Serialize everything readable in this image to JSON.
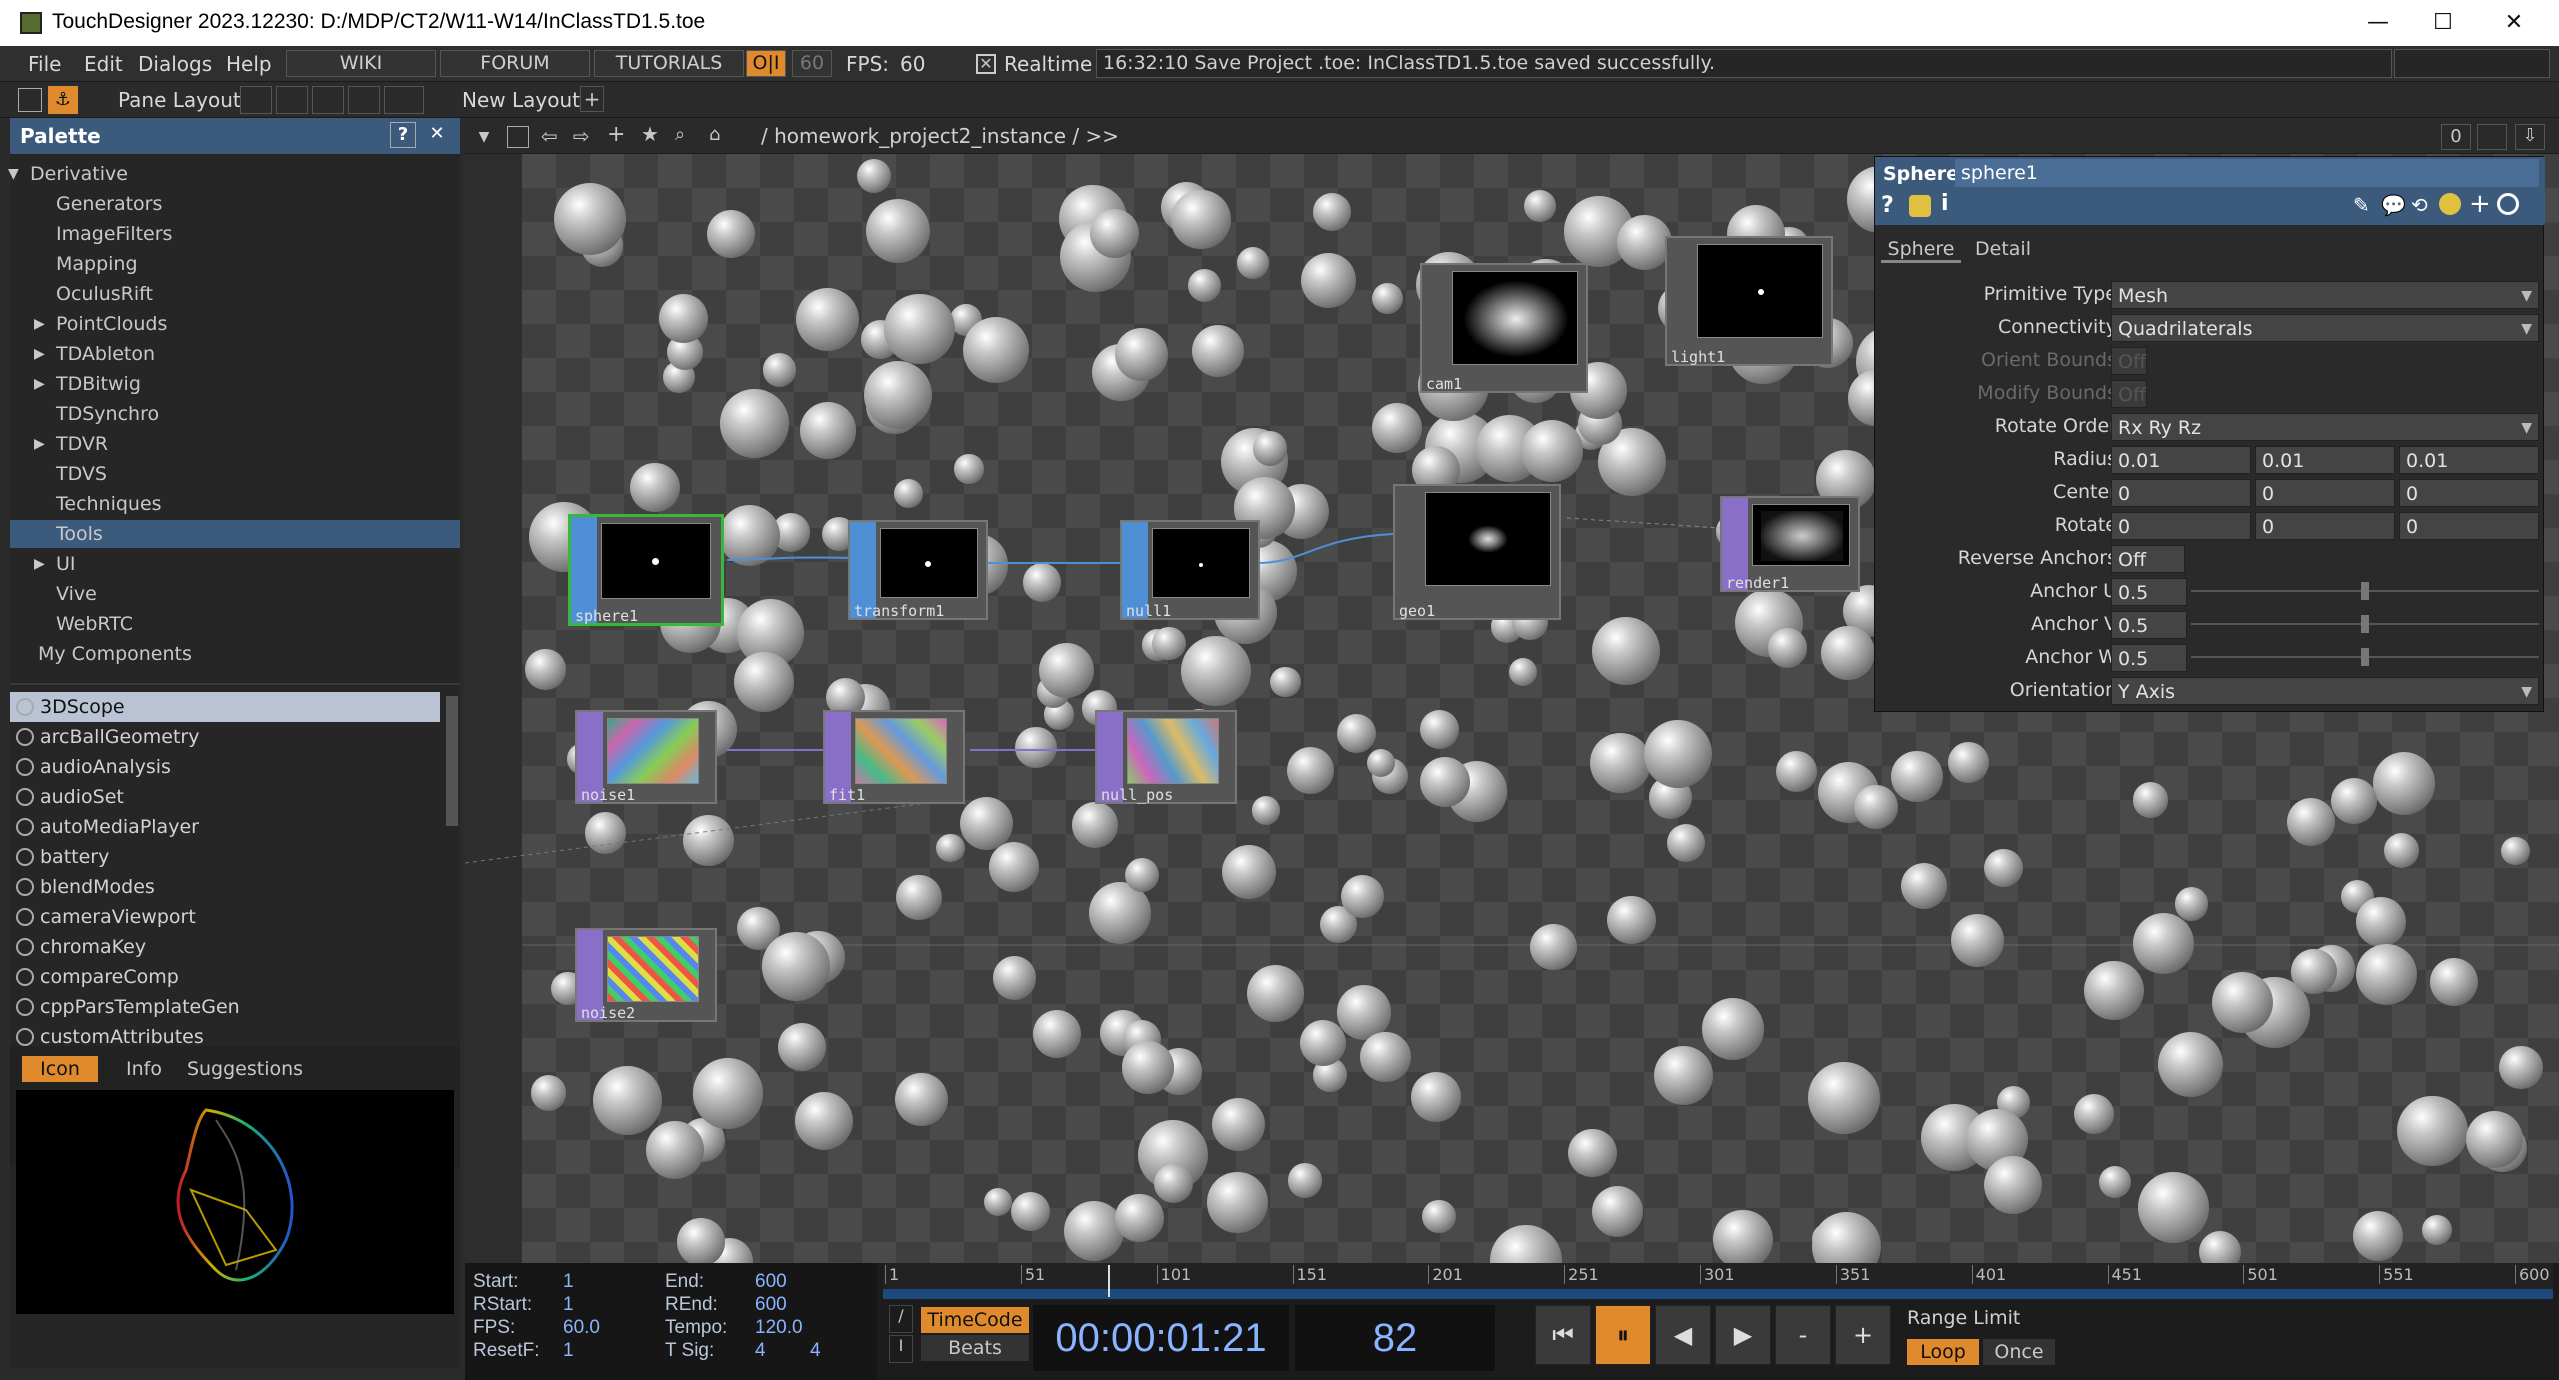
{
  "window": {
    "title": "TouchDesigner 2023.12230: D:/MDP/CT2/W11-W14/InClassTD1.5.toe",
    "minimize": "—",
    "maximize": "☐",
    "close": "✕"
  },
  "menu": {
    "file": "File",
    "edit": "Edit",
    "dialogs": "Dialogs",
    "help": "Help",
    "wiki": "WIKI",
    "forum": "FORUM",
    "tutorials": "TUTORIALS",
    "oi": "O|I",
    "fps_target": "60",
    "fps_label": "FPS:",
    "fps_value": "60",
    "realtime_label": "Realtime",
    "status": "16:32:10 Save Project .toe: InClassTD1.5.toe saved successfully."
  },
  "toolbar": {
    "pane_layout": "Pane Layout",
    "new_layout": "New Layout",
    "add": "+"
  },
  "palette": {
    "title": "Palette",
    "help": "?",
    "close": "✕",
    "tree": [
      {
        "label": "Derivative",
        "arrow": "▼"
      },
      {
        "label": "Generators",
        "arrow": ""
      },
      {
        "label": "ImageFilters",
        "arrow": ""
      },
      {
        "label": "Mapping",
        "arrow": ""
      },
      {
        "label": "OculusRift",
        "arrow": ""
      },
      {
        "label": "PointClouds",
        "arrow": "▶"
      },
      {
        "label": "TDAbleton",
        "arrow": "▶"
      },
      {
        "label": "TDBitwig",
        "arrow": "▶"
      },
      {
        "label": "TDSynchro",
        "arrow": ""
      },
      {
        "label": "TDVR",
        "arrow": "▶"
      },
      {
        "label": "TDVS",
        "arrow": ""
      },
      {
        "label": "Techniques",
        "arrow": ""
      },
      {
        "label": "Tools",
        "arrow": ""
      },
      {
        "label": "UI",
        "arrow": "▶"
      },
      {
        "label": "Vive",
        "arrow": ""
      },
      {
        "label": "WebRTC",
        "arrow": ""
      },
      {
        "label": "My Components",
        "arrow": ""
      }
    ],
    "components": [
      "3DScope",
      "arcBallGeometry",
      "audioAnalysis",
      "audioSet",
      "autoMediaPlayer",
      "battery",
      "blendModes",
      "cameraViewport",
      "chromaKey",
      "compareComp",
      "cppParsTemplateGen",
      "customAttributes"
    ],
    "tabs": {
      "icon": "Icon",
      "info": "Info",
      "suggestions": "Suggestions"
    }
  },
  "network": {
    "path": "/ homework_project2_instance / >>",
    "zero": "0",
    "nodes": {
      "sphere1": "sphere1",
      "transform1": "transform1",
      "null1": "null1",
      "geo1": "geo1",
      "cam1": "cam1",
      "light1": "light1",
      "render1": "render1",
      "noise1": "noise1",
      "fit1": "fit1",
      "null_pos": "null_pos",
      "noise2": "noise2"
    }
  },
  "params": {
    "type": "Sphere",
    "name": "sphere1",
    "tabs": {
      "sphere": "Sphere",
      "detail": "Detail"
    },
    "primitive_type": {
      "label": "Primitive Type",
      "value": "Mesh"
    },
    "connectivity": {
      "label": "Connectivity",
      "value": "Quadrilaterals"
    },
    "orient_bounds": {
      "label": "Orient Bounds",
      "value": "Off"
    },
    "modify_bounds": {
      "label": "Modify Bounds",
      "value": "Off"
    },
    "rotate_order": {
      "label": "Rotate Order",
      "value": "Rx Ry Rz"
    },
    "radius": {
      "label": "Radius",
      "x": "0.01",
      "y": "0.01",
      "z": "0.01"
    },
    "center": {
      "label": "Center",
      "x": "0",
      "y": "0",
      "z": "0"
    },
    "rotate": {
      "label": "Rotate",
      "x": "0",
      "y": "0",
      "z": "0"
    },
    "reverse_anchors": {
      "label": "Reverse Anchors",
      "value": "Off"
    },
    "anchor_u": {
      "label": "Anchor U",
      "value": "0.5"
    },
    "anchor_v": {
      "label": "Anchor V",
      "value": "0.5"
    },
    "anchor_w": {
      "label": "Anchor W",
      "value": "0.5"
    },
    "orientation": {
      "label": "Orientation",
      "value": "Y Axis"
    }
  },
  "timeline": {
    "start_label": "Start:",
    "start": "1",
    "end_label": "End:",
    "end": "600",
    "rstart_label": "RStart:",
    "rstart": "1",
    "rend_label": "REnd:",
    "rend": "600",
    "fps_label": "FPS:",
    "fps": "60.0",
    "tempo_label": "Tempo:",
    "tempo": "120.0",
    "resetf_label": "ResetF:",
    "resetf": "1",
    "tsig_label": "T Sig:",
    "tsig_a": "4",
    "tsig_b": "4",
    "timecode": "TimeCode",
    "beats": "Beats",
    "time": "00:00:01:21",
    "frame": "82",
    "range_limit": "Range Limit",
    "loop": "Loop",
    "once": "Once",
    "ruler": [
      "1",
      "51",
      "101",
      "151",
      "201",
      "251",
      "301",
      "351",
      "401",
      "451",
      "501",
      "551",
      "600"
    ],
    "playhead_fraction": 0.135
  },
  "colors": {
    "accent": "#e08a2e",
    "sop": "#4f8fd6",
    "top": "#8a6fc8",
    "header": "#3c5b7c",
    "selected": "#38b838"
  }
}
